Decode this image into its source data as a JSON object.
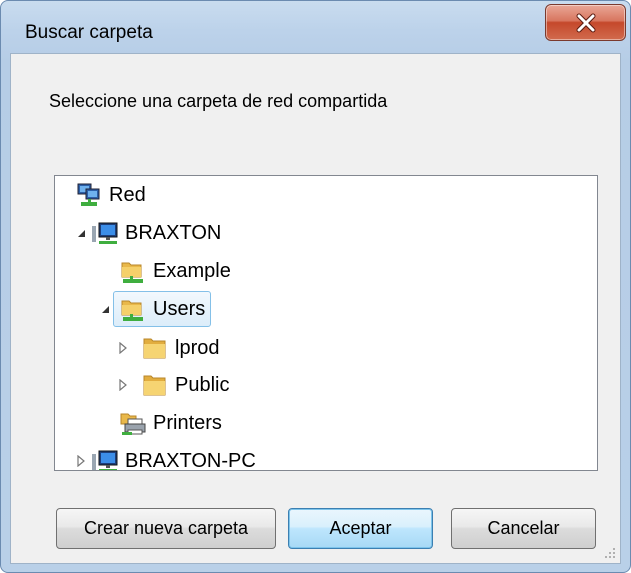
{
  "window": {
    "title": "Buscar carpeta",
    "instruction": "Seleccione una carpeta de red compartida"
  },
  "tree": {
    "items": [
      {
        "label": "Red",
        "icon": "network-icon",
        "expanded": null
      },
      {
        "label": "BRAXTON",
        "icon": "computer-icon",
        "expanded": true
      },
      {
        "label": "Example",
        "icon": "shared-folder-icon",
        "expanded": null
      },
      {
        "label": "Users",
        "icon": "shared-folder-icon",
        "expanded": true,
        "selected": true
      },
      {
        "label": "lprod",
        "icon": "folder-icon",
        "expanded": false
      },
      {
        "label": "Public",
        "icon": "folder-icon",
        "expanded": false
      },
      {
        "label": "Printers",
        "icon": "printer-icon",
        "expanded": null
      },
      {
        "label": "BRAXTON-PC",
        "icon": "computer-icon",
        "expanded": false
      }
    ]
  },
  "buttons": {
    "new_folder": "Crear nueva carpeta",
    "ok": "Aceptar",
    "cancel": "Cancelar"
  },
  "colors": {
    "frame": "#b9d0e8",
    "close_red": "#c5482b",
    "selection_border": "#84c0e8",
    "default_button": "#bee6fd"
  }
}
